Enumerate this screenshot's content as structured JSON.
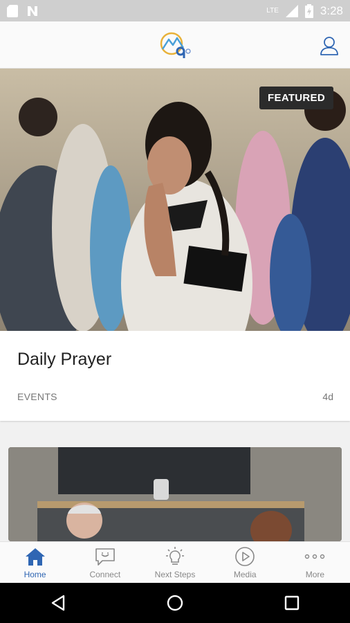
{
  "status_bar": {
    "time": "3:28",
    "network": "LTE"
  },
  "header": {
    "logo_icon": "church-logo-icon",
    "profile_icon": "user-icon"
  },
  "featured_card": {
    "badge": "FEATURED",
    "title": "Daily Prayer",
    "category": "EVENTS",
    "age": "4d"
  },
  "bottom_nav": {
    "items": [
      {
        "label": "Home",
        "icon": "home-icon",
        "active": true
      },
      {
        "label": "Connect",
        "icon": "chat-icon",
        "active": false
      },
      {
        "label": "Next Steps",
        "icon": "lightbulb-icon",
        "active": false
      },
      {
        "label": "Media",
        "icon": "play-icon",
        "active": false
      },
      {
        "label": "More",
        "icon": "more-icon",
        "active": false
      }
    ]
  },
  "colors": {
    "accent": "#2f66b3",
    "inactive": "#888888",
    "badge_bg": "#2b2b2b"
  }
}
